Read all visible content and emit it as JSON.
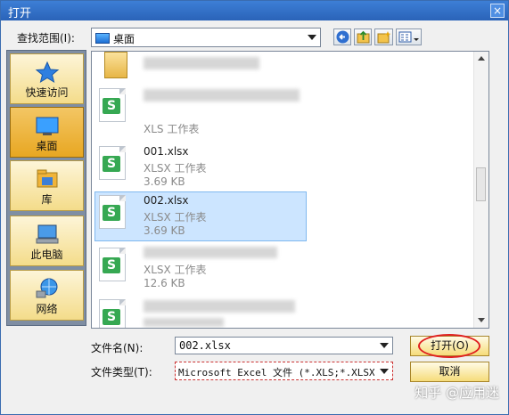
{
  "window": {
    "title": "打开",
    "close": "×"
  },
  "lookin": {
    "label": "查找范围(I):",
    "value": "桌面"
  },
  "places": [
    {
      "label": "快速访问",
      "icon": "star-icon"
    },
    {
      "label": "桌面",
      "icon": "desktop-icon"
    },
    {
      "label": "库",
      "icon": "library-icon"
    },
    {
      "label": "此电脑",
      "icon": "computer-icon"
    },
    {
      "label": "网络",
      "icon": "network-icon"
    }
  ],
  "files": [
    {
      "name": "",
      "type": "",
      "size": "",
      "kind": "folder"
    },
    {
      "name": "",
      "type": "XLS 工作表",
      "size": "",
      "kind": "xls"
    },
    {
      "name": "001.xlsx",
      "type": "XLSX 工作表",
      "size": "3.69 KB",
      "kind": "xls"
    },
    {
      "name": "002.xlsx",
      "type": "XLSX 工作表",
      "size": "3.69 KB",
      "kind": "xls",
      "selected": true
    },
    {
      "name": "",
      "type": "XLSX 工作表",
      "size": "12.6 KB",
      "kind": "xls"
    },
    {
      "name": "",
      "type": "",
      "size": "",
      "kind": "xls"
    }
  ],
  "filename": {
    "label": "文件名(N):",
    "value": "002.xlsx"
  },
  "filetype": {
    "label": "文件类型(T):",
    "value": "Microsoft Excel 文件 (*.XLS;*.XLSX;*."
  },
  "buttons": {
    "open": "打开(O)",
    "cancel": "取消"
  },
  "watermark": "知乎 @应用迷",
  "colors": {
    "title_bar": "#2a63b8",
    "selection": "#cce5ff",
    "button": "#f6dc7a",
    "highlight_ring": "#e02020"
  }
}
